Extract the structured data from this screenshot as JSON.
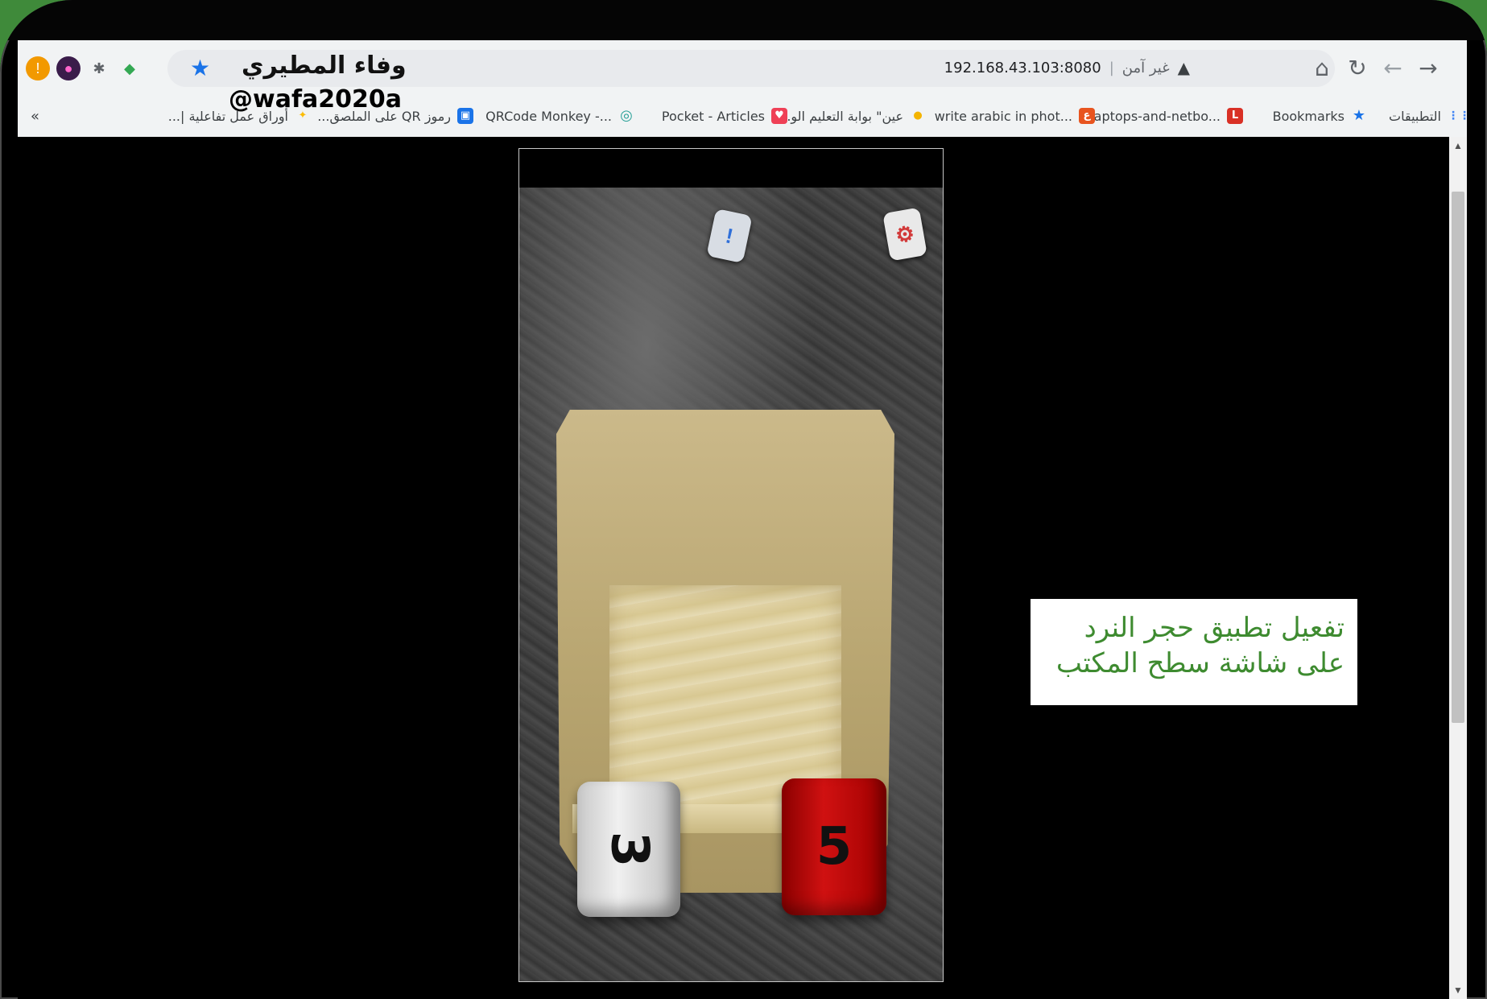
{
  "browser": {
    "profile_name": "وفاء المطيري",
    "profile_handle": "@wafa2020a",
    "url": "192.168.43.103:8080",
    "security_label": "غير آمن",
    "nav_glyphs": {
      "back": "←",
      "forward": "→",
      "reload": "↻",
      "home": "⌂",
      "star": "★",
      "warn": "▲"
    },
    "bookmarks_overflow": "«",
    "bookmarks": [
      {
        "label": "التطبيقات",
        "icon": "apps-grid-icon",
        "color": "#4285f4",
        "glyph": "⋮⋮"
      },
      {
        "label": "Bookmarks",
        "icon": "star-icon",
        "color": "#1a73e8",
        "glyph": "★"
      },
      {
        "label": "Laptops-and-netbo...",
        "icon": "l-favicon",
        "color": "#d93025",
        "glyph": "L"
      },
      {
        "label": "write arabic in phot...",
        "icon": "e-favicon",
        "color": "#e8541f",
        "glyph": "ع"
      },
      {
        "label": "عين\" بوابة التعليم الو...",
        "icon": "ein-favicon",
        "color": "#f4b400",
        "glyph": "●"
      },
      {
        "label": "Pocket - Articles",
        "icon": "pocket-icon",
        "color": "#ef4056",
        "glyph": "♥"
      },
      {
        "label": "QRCode Monkey -...",
        "icon": "monkey-icon",
        "color": "#2aa198",
        "glyph": "◎"
      },
      {
        "label": "رموز QR على الملصق...",
        "icon": "qr-icon",
        "color": "#1a73e8",
        "glyph": "▣"
      },
      {
        "label": "أوراق عمل تفاعلية |...",
        "icon": "bulb-icon",
        "color": "#fbbc04",
        "glyph": "✦"
      }
    ]
  },
  "game": {
    "info_button_glyph": "!",
    "settings_button_glyph": "⚙",
    "dice": [
      {
        "value": "3",
        "color": "white"
      },
      {
        "value": "5",
        "color": "red"
      }
    ]
  },
  "caption": {
    "line1": "تفعيل تطبيق حجر النرد",
    "line2": "على شاشة سطح المكتب"
  }
}
